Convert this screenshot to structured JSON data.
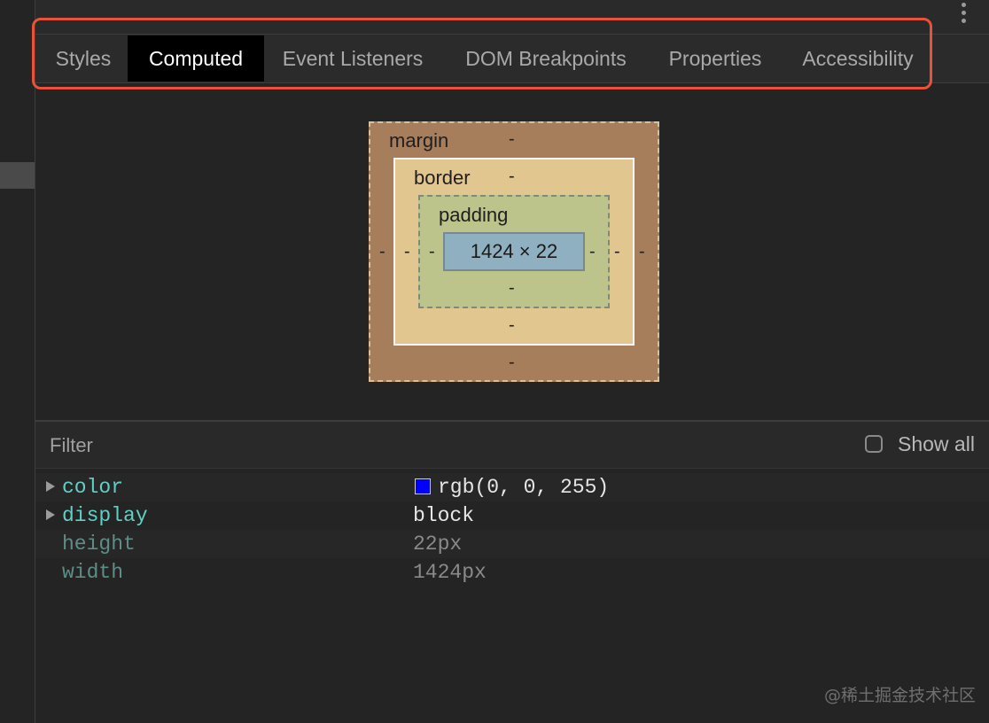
{
  "tabs": [
    {
      "label": "Styles"
    },
    {
      "label": "Computed"
    },
    {
      "label": "Event Listeners"
    },
    {
      "label": "DOM Breakpoints"
    },
    {
      "label": "Properties"
    },
    {
      "label": "Accessibility"
    }
  ],
  "active_tab": "Computed",
  "more_menu_icon": "kebab-vertical-icon",
  "box_model": {
    "margin": {
      "label": "margin",
      "top": "-",
      "right": "-",
      "bottom": "-",
      "left": "-"
    },
    "border": {
      "label": "border",
      "top": "-",
      "right": "-",
      "bottom": "-",
      "left": "-"
    },
    "padding": {
      "label": "padding",
      "top": "-",
      "right": "-",
      "bottom": "-",
      "left": "-"
    },
    "content": "1424 × 22"
  },
  "filter": {
    "placeholder": "Filter",
    "value": ""
  },
  "show_all": {
    "label": "Show all",
    "checked": false
  },
  "properties": [
    {
      "name": "color",
      "value": "rgb(0, 0, 255)",
      "swatch": "#0000ff",
      "expandable": true,
      "inherited": false
    },
    {
      "name": "display",
      "value": "block",
      "expandable": true,
      "inherited": false
    },
    {
      "name": "height",
      "value": "22px",
      "expandable": false,
      "inherited": true
    },
    {
      "name": "width",
      "value": "1424px",
      "expandable": false,
      "inherited": true
    }
  ],
  "watermark": "@稀土掘金技术社区",
  "colors": {
    "highlight": "#e8523a",
    "margin": "#a67e5c",
    "border": "#e2c68f",
    "padding": "#bcc38b",
    "content": "#8eb0c0",
    "property_name": "#5fd1c4"
  }
}
